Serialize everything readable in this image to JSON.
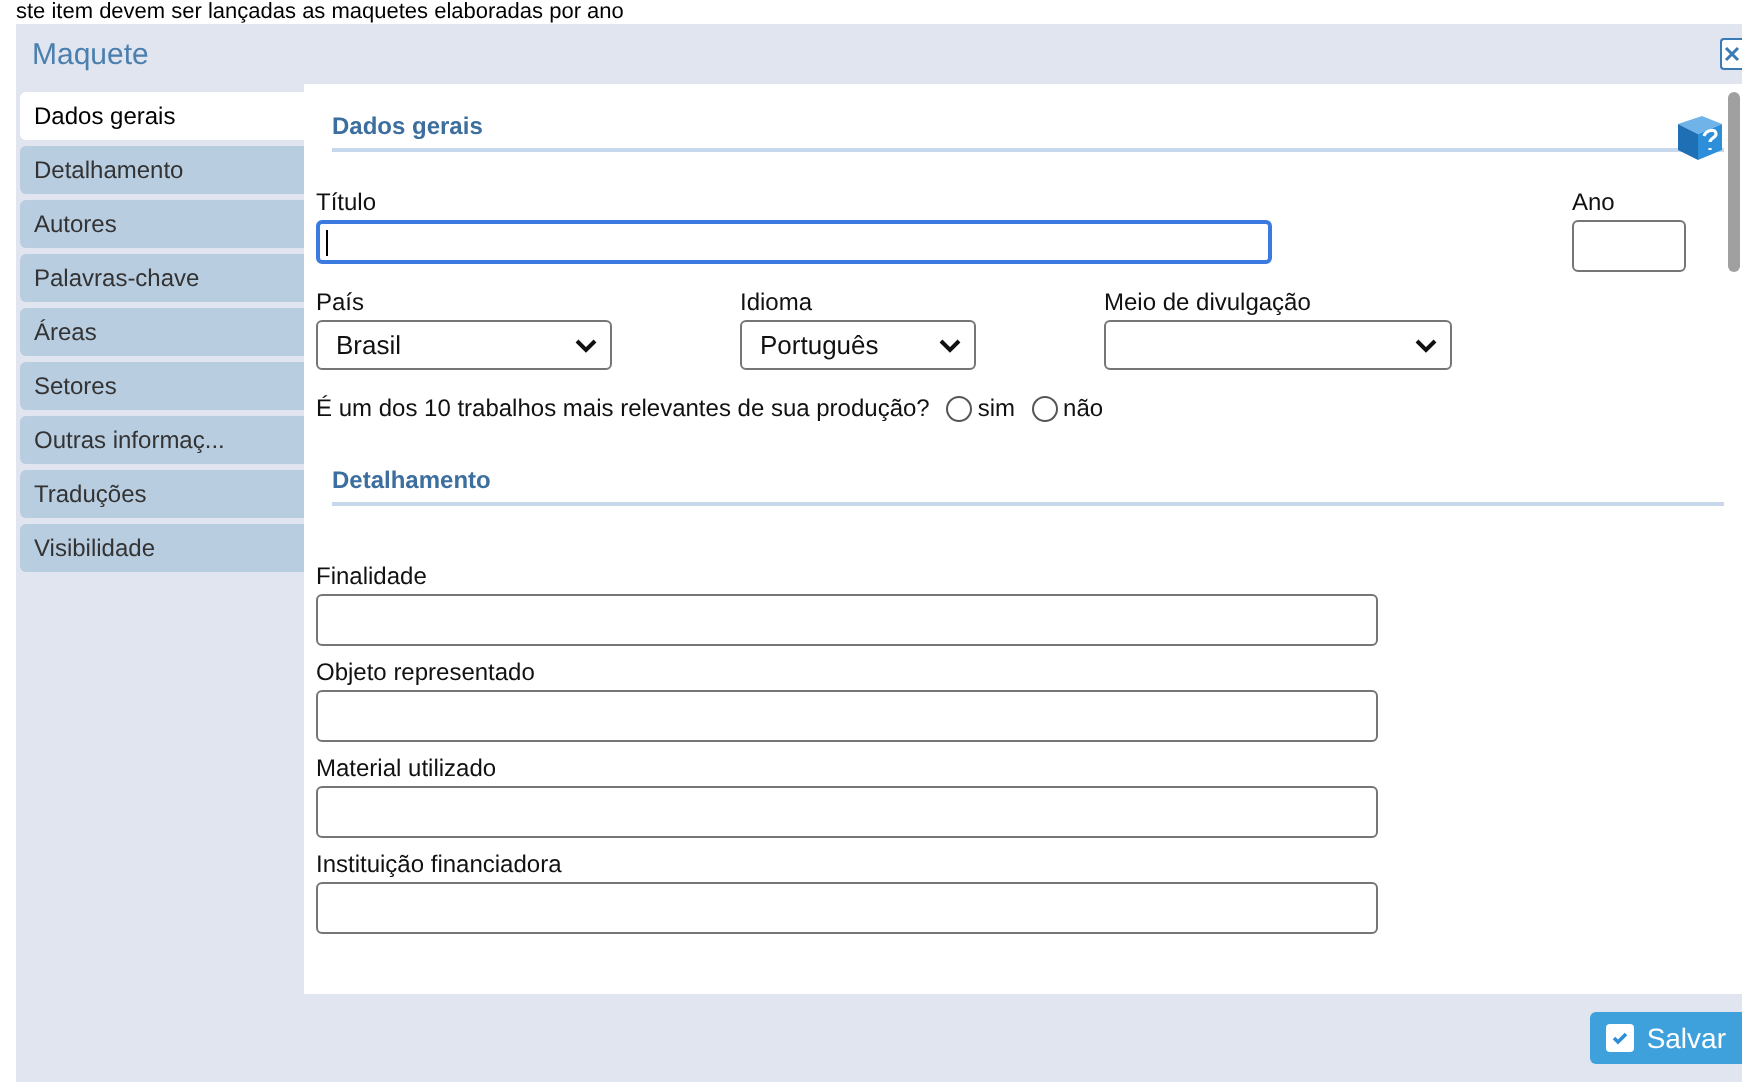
{
  "background_text": "ste item devem ser lançadas as maquetes elaboradas por ano",
  "dialog": {
    "title": "Maquete"
  },
  "sidebar": {
    "items": [
      {
        "label": "Dados gerais",
        "selected": true
      },
      {
        "label": "Detalhamento",
        "selected": false
      },
      {
        "label": "Autores",
        "selected": false
      },
      {
        "label": "Palavras-chave",
        "selected": false
      },
      {
        "label": "Áreas",
        "selected": false
      },
      {
        "label": "Setores",
        "selected": false
      },
      {
        "label": "Outras informaç...",
        "selected": false
      },
      {
        "label": "Traduções",
        "selected": false
      },
      {
        "label": "Visibilidade",
        "selected": false
      }
    ]
  },
  "dados_gerais": {
    "heading": "Dados gerais",
    "titulo": {
      "label": "Título",
      "focused": true
    },
    "ano": {
      "label": "Ano"
    },
    "selects": [
      {
        "label": "País",
        "value": "Brasil"
      },
      {
        "label": "Idioma",
        "value": "Português"
      },
      {
        "label": "Meio de divulgação"
      }
    ],
    "relevance": {
      "question": "É um dos 10 trabalhos mais relevantes de sua produção?",
      "options": [
        {
          "label": "sim",
          "selected": false
        },
        {
          "label": "não",
          "selected": false
        }
      ]
    }
  },
  "detalhamento": {
    "heading": "Detalhamento",
    "fields": [
      {
        "label": "Finalidade"
      },
      {
        "label": "Objeto representado"
      },
      {
        "label": "Material utilizado"
      },
      {
        "label": "Instituição financiadora"
      }
    ]
  },
  "save_button": {
    "label": "Salvar"
  }
}
